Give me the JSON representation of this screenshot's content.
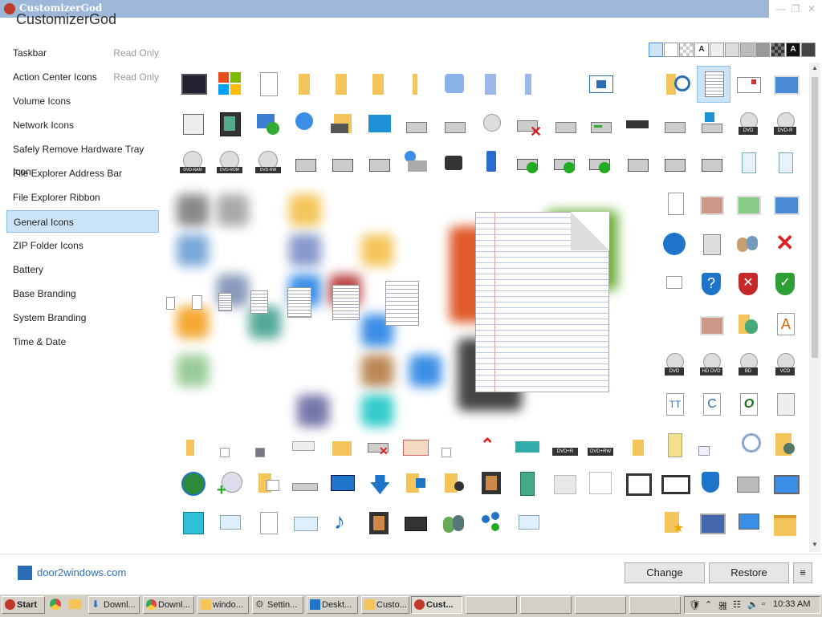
{
  "window": {
    "title": "CustomizerGod",
    "heading": "CustomizerGod"
  },
  "sidebar": {
    "items": [
      {
        "label": "Taskbar",
        "badge": "Read Only"
      },
      {
        "label": "Action Center Icons",
        "badge": "Read Only"
      },
      {
        "label": "Volume Icons",
        "badge": ""
      },
      {
        "label": "Network Icons",
        "badge": ""
      },
      {
        "label": "Safely Remove Hardware Tray Icon",
        "badge": ""
      },
      {
        "label": "File Explorer Address Bar",
        "badge": ""
      },
      {
        "label": "File Explorer Ribbon",
        "badge": ""
      },
      {
        "label": "General Icons",
        "badge": ""
      },
      {
        "label": "ZIP Folder Icons",
        "badge": ""
      },
      {
        "label": "Battery",
        "badge": ""
      },
      {
        "label": "Base Branding",
        "badge": ""
      },
      {
        "label": "System Branding",
        "badge": ""
      },
      {
        "label": "Time & Date",
        "badge": ""
      }
    ],
    "active_index": 7
  },
  "swatches": {
    "letter": "A"
  },
  "icon_labels": {
    "dvd_ram": "DVD-RAM",
    "dvd_rom": "DVD-ROM",
    "dvd_rw": "DVD-RW",
    "dvd": "DVD",
    "dvd_r": "DVD-R",
    "hd_dvd": "HD DVD",
    "bd": "BD",
    "vcd": "VCD",
    "dvd_plus_r": "DVD+R",
    "dvd_plus_rw": "DVD+RW",
    "font_a": "A",
    "font_o": "O",
    "font_c": "C",
    "font_t": "TT"
  },
  "footer": {
    "brand": "door2windows.com",
    "change": "Change",
    "restore": "Restore",
    "menu": "≡"
  },
  "taskbar": {
    "start": "Start",
    "items": [
      "Downl...",
      "Downl...",
      "windo...",
      "Settin...",
      "Deskt...",
      "Custo...",
      "Cust..."
    ],
    "active_index": 6,
    "clock": "10:33 AM"
  },
  "colors": {
    "accent": "#2d6db5",
    "active_bg": "#cce4f7",
    "title_bar": "#9db7d8"
  }
}
